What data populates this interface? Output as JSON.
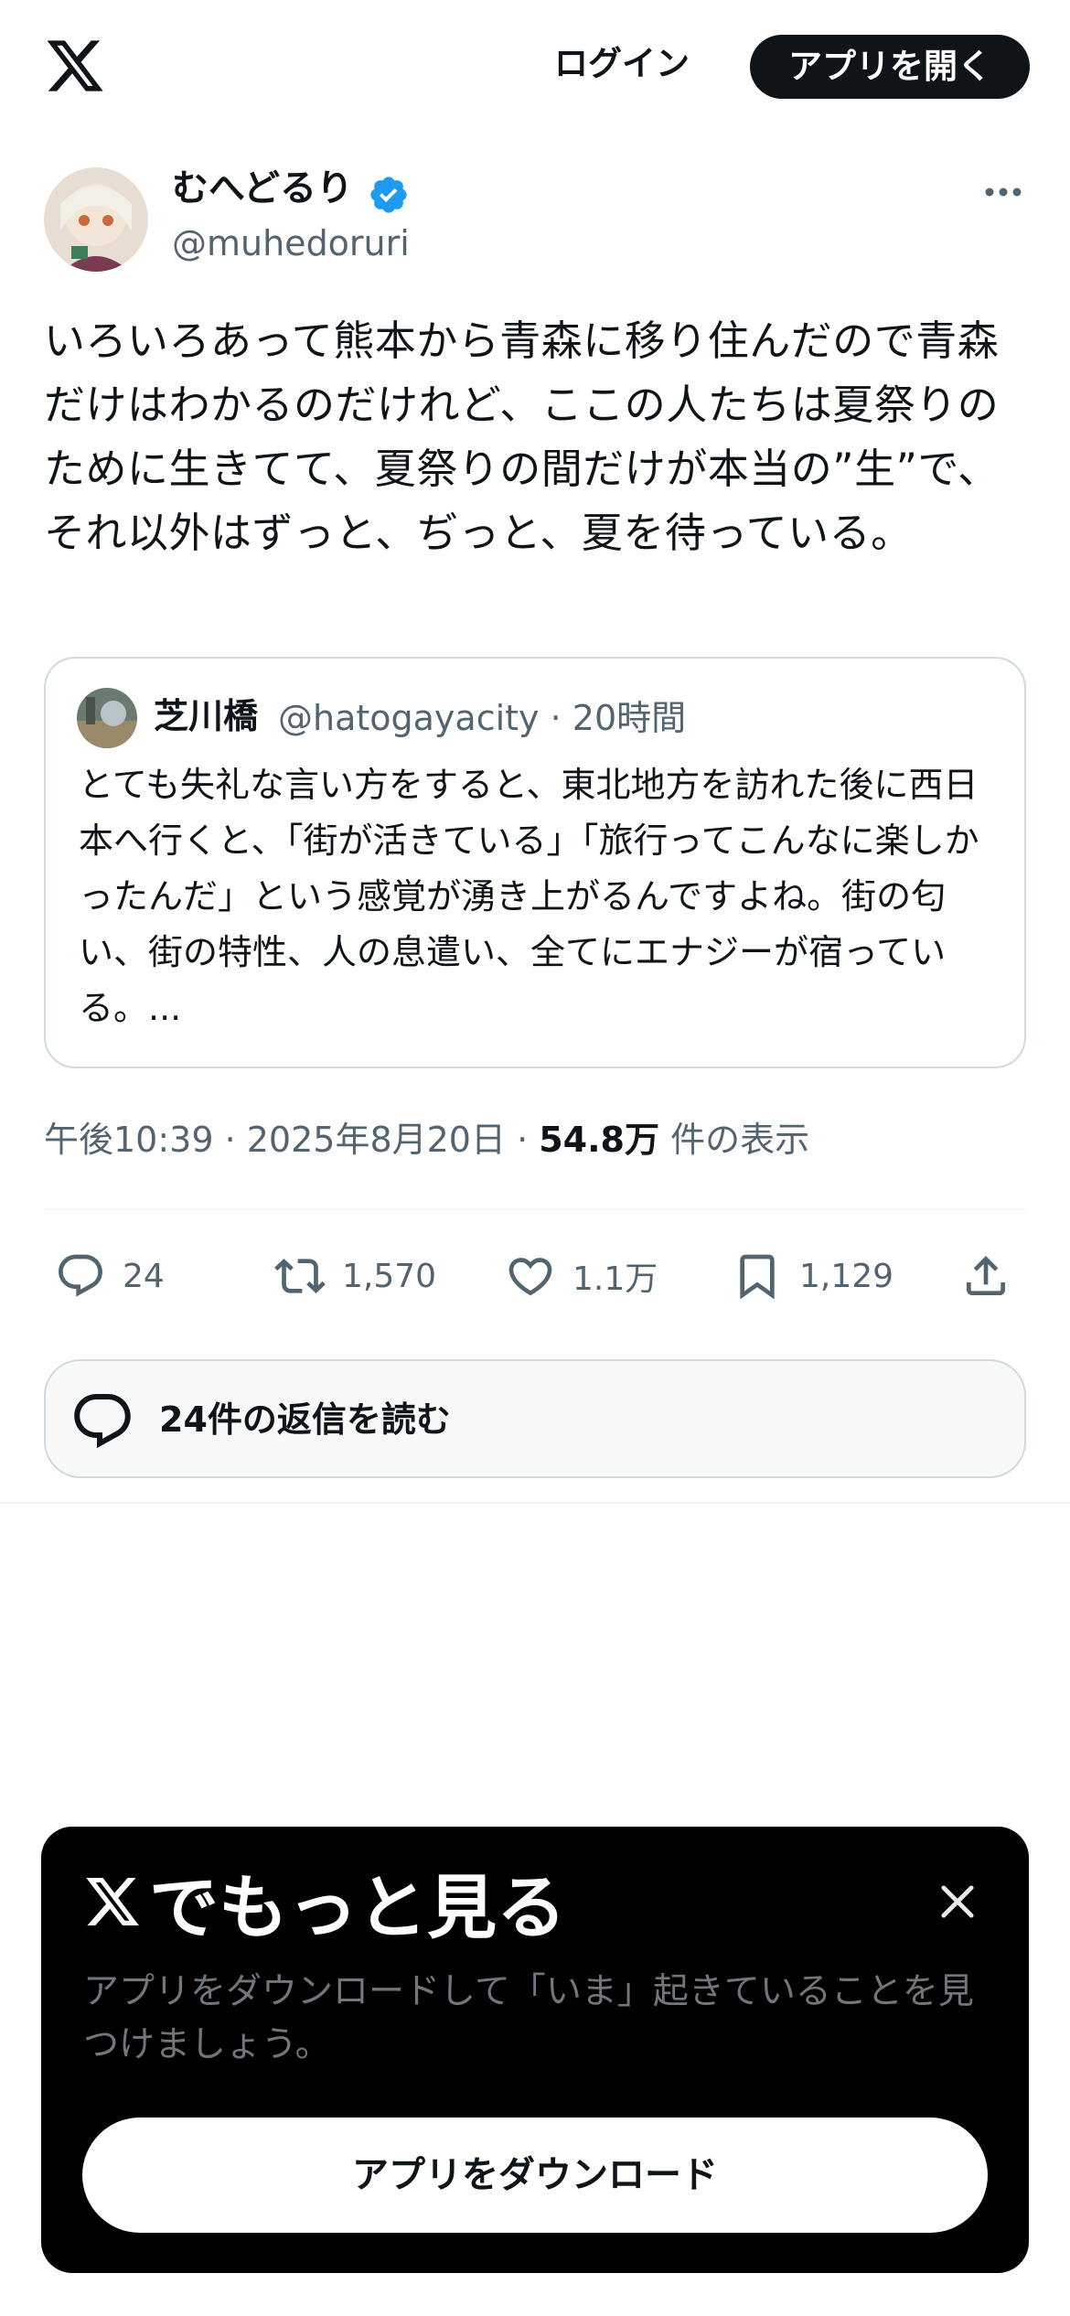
{
  "header": {
    "logo_icon": "x-logo-icon",
    "login_label": "ログイン",
    "open_app_label": "アプリを開く"
  },
  "tweet": {
    "author_name": "むへどるり",
    "author_handle": "@muhedoruri",
    "verified_icon": "verified-badge-icon",
    "text": "いろいろあって熊本から青森に移り住んだので青森だけはわかるのだけれど、ここの人たちは夏祭りのために生きてて、夏祭りの間だけが本当の”生”で、それ以外はずっと、ぢっと、夏を待っている。",
    "timestamp": "午後10:39 · 2025年8月20日 · ",
    "views_count": "54.8万",
    "views_label": " 件の表示"
  },
  "quote": {
    "author_name": "芝川橋",
    "author_handle": "@hatogayacity · 20時間",
    "text": "とても失礼な言い方をすると、東北地方を訪れた後に西日本へ行くと、「街が活きている」「旅行ってこんなに楽しかったんだ」という感覚が湧き上がるんですよね。街の匂い、街の特性、人の息遣い、全てにエナジーが宿っている。..."
  },
  "actions": {
    "replies": "24",
    "reposts": "1,570",
    "likes": "1.1万",
    "bookmarks": "1,129"
  },
  "read_replies_label": "24件の返信を読む",
  "promo": {
    "title": "でもっと見る",
    "description": "アプリをダウンロードして「いま」起きていることを見つけましょう。",
    "download_label": "アプリをダウンロード"
  },
  "colors": {
    "text_primary": "#0f1419",
    "text_secondary": "#536471",
    "verified_blue": "#1d9bf0",
    "border": "#cfd9de"
  }
}
